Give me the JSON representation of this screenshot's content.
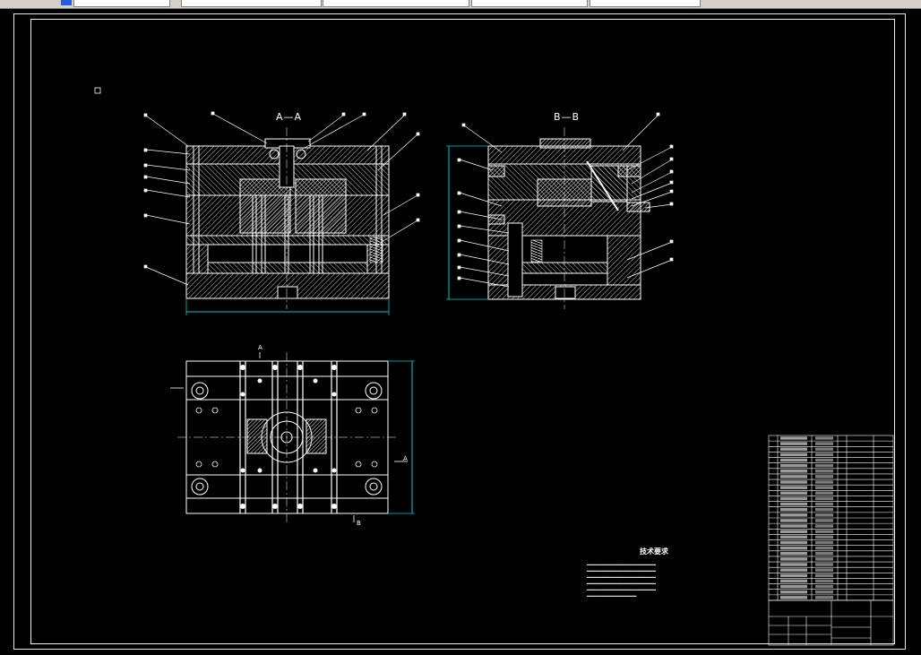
{
  "toolbar": {
    "segments": [
      "",
      "",
      "",
      "",
      ""
    ]
  },
  "views": {
    "section_a": {
      "label": "A—A"
    },
    "section_b": {
      "label": "B—B"
    }
  },
  "plan_view": {
    "cut_marker_top": "A",
    "cut_marker_right": "A",
    "cut_marker_bottom": "B"
  },
  "technical_notes": {
    "title": "技术要求"
  },
  "colors": {
    "background": "#000000",
    "line": "#ffffff",
    "hatch": "#e0e0e0",
    "dimension": "#00c8c8",
    "centerline": "#ffffff",
    "fill_dark": "#222222"
  },
  "bom": {
    "row_count": 30
  }
}
